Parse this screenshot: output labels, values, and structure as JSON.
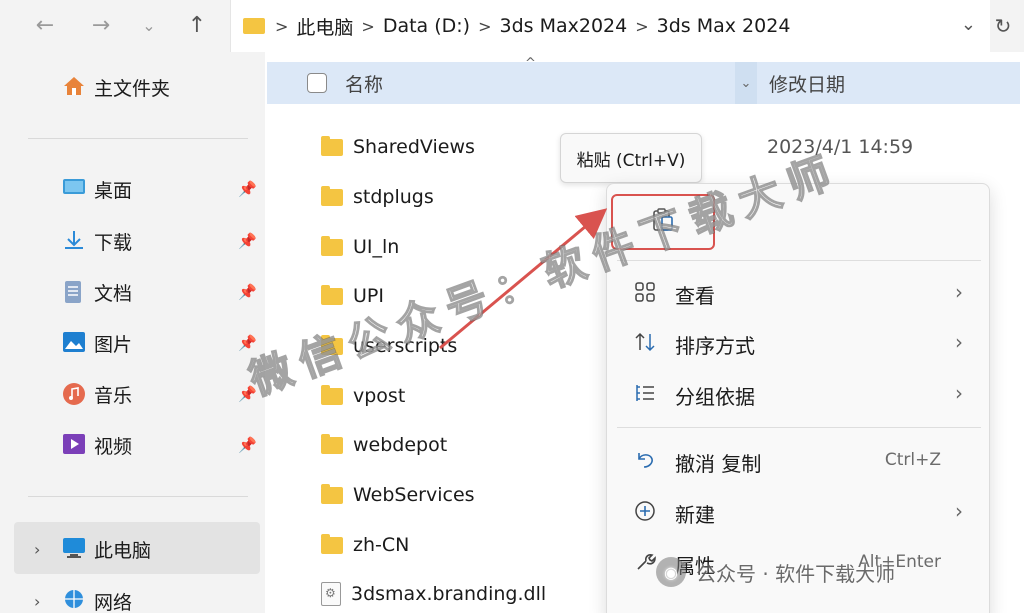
{
  "toolbar": {
    "back_icon": "arrow-left-icon",
    "forward_icon": "arrow-right-icon",
    "recent_icon": "chevron-down-icon",
    "up_icon": "arrow-up-icon"
  },
  "address_bar": {
    "breadcrumbs": [
      "此电脑",
      "Data (D:)",
      "3ds Max2024",
      "3ds Max 2024"
    ],
    "separator": ">"
  },
  "sidebar": {
    "home": "主文件夹",
    "quick_access": [
      {
        "label": "桌面",
        "icon": "desktop-icon"
      },
      {
        "label": "下载",
        "icon": "download-icon"
      },
      {
        "label": "文档",
        "icon": "document-icon"
      },
      {
        "label": "图片",
        "icon": "pictures-icon"
      },
      {
        "label": "音乐",
        "icon": "music-icon"
      },
      {
        "label": "视频",
        "icon": "video-icon"
      }
    ],
    "this_pc": "此电脑",
    "network": "网络"
  },
  "file_list": {
    "columns": {
      "name": "名称",
      "modified": "修改日期"
    },
    "items": [
      {
        "name": "SharedViews",
        "type": "folder",
        "modified": "2023/4/1 14:59"
      },
      {
        "name": "stdplugs",
        "type": "folder"
      },
      {
        "name": "UI_ln",
        "type": "folder"
      },
      {
        "name": "UPI",
        "type": "folder"
      },
      {
        "name": "userscripts",
        "type": "folder"
      },
      {
        "name": "vpost",
        "type": "folder"
      },
      {
        "name": "webdepot",
        "type": "folder"
      },
      {
        "name": "WebServices",
        "type": "folder"
      },
      {
        "name": "zh-CN",
        "type": "folder"
      },
      {
        "name": "3dsmax.branding.dll",
        "type": "dll"
      }
    ]
  },
  "tooltip": {
    "text": "粘贴 (Ctrl+V)"
  },
  "context_menu": {
    "paste_icon": "clipboard-paste-icon",
    "items": [
      {
        "label": "查看",
        "icon": "grid-view-icon",
        "submenu": true
      },
      {
        "label": "排序方式",
        "icon": "sort-icon",
        "submenu": true
      },
      {
        "label": "分组依据",
        "icon": "group-list-icon",
        "submenu": true
      },
      {
        "label": "撤消 复制",
        "icon": "undo-icon",
        "shortcut": "Ctrl+Z"
      },
      {
        "label": "新建",
        "icon": "new-plus-icon",
        "submenu": true
      },
      {
        "label": "属性",
        "icon": "wrench-icon",
        "shortcut": "Alt+Enter"
      }
    ]
  },
  "watermark": {
    "diagonal": "微信公众号：软件下载大师",
    "footer": "公众号 · 软件下载大师"
  },
  "colors": {
    "accent": "#0067c0",
    "highlight_box": "#d9534f",
    "annotation_arrow": "#d9534f",
    "folder": "#f4c542",
    "header_selected": "#dce8f7"
  }
}
